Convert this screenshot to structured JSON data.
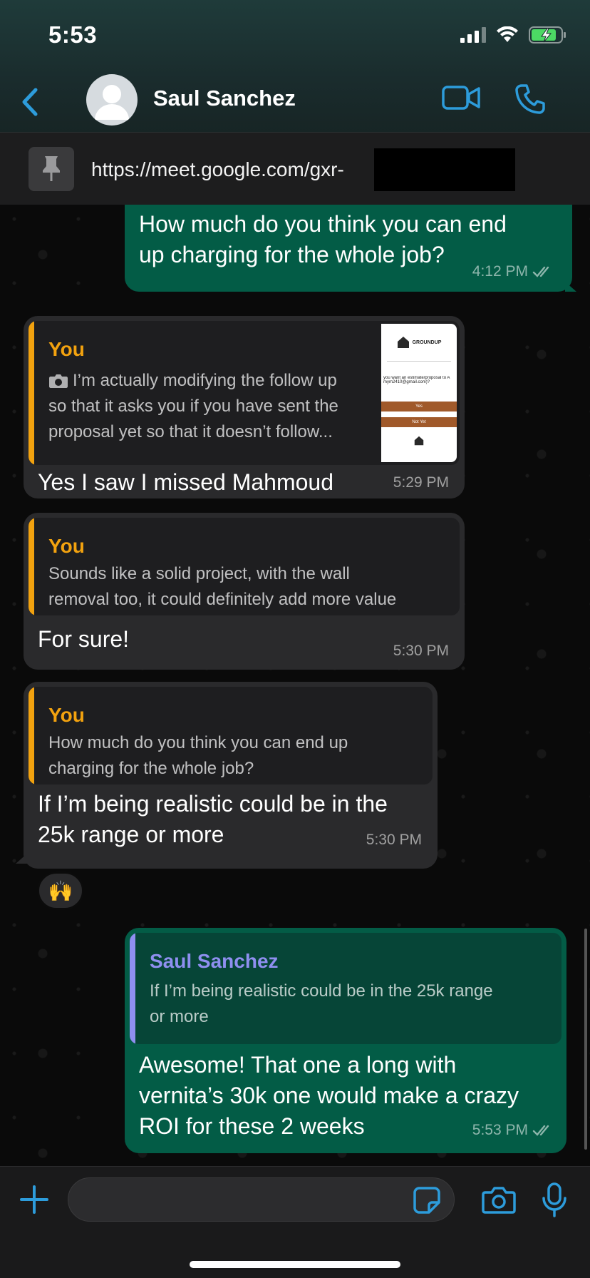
{
  "status": {
    "time": "5:53"
  },
  "header": {
    "contact_name": "Saul Sanchez"
  },
  "pinned": {
    "text": "https://meet.google.com/gxr-"
  },
  "messages": [
    {
      "direction": "outgoing",
      "text_lines": [
        "How much do you think you can end",
        "up charging for the whole job?"
      ],
      "time": "4:12 PM"
    },
    {
      "direction": "incoming",
      "quote_author": "You",
      "quote_lines": [
        "I’m actually modifying the follow up",
        "so that it asks you if you have sent the",
        "proposal yet so that it doesn’t follow..."
      ],
      "quote_has_photo": true,
      "thumb": {
        "brand": "GROUNDUP",
        "line1": "you want an estimate/proposal to A",
        "line2": "mym2410@gmail.com)?",
        "btn1": "Yes",
        "btn2": "Not Yet"
      },
      "text": "Yes I saw I missed Mahmoud",
      "time": "5:29 PM"
    },
    {
      "direction": "incoming",
      "quote_author": "You",
      "quote_lines": [
        "Sounds like a solid project, with the wall",
        "removal too, it could definitely add more value"
      ],
      "text": "For sure!",
      "time": "5:30 PM"
    },
    {
      "direction": "incoming",
      "quote_author": "You",
      "quote_lines": [
        "How much do you think you can end up",
        "charging for the whole job?"
      ],
      "text_lines": [
        "If I’m being realistic could be in the",
        "25k range or more"
      ],
      "time": "5:30 PM",
      "reaction": "🙌"
    },
    {
      "direction": "outgoing",
      "quote_author": "Saul Sanchez",
      "quote_lines": [
        "If I’m being realistic could be in the 25k range",
        "or more"
      ],
      "text_lines": [
        "Awesome! That one a long with",
        "vernita’s 30k one would make a crazy",
        "ROI for these 2 weeks"
      ],
      "time": "5:53 PM"
    }
  ],
  "colors": {
    "accent": "#2d9cdb",
    "outgoing_bubble": "#035c46",
    "incoming_bubble": "#2a2a2c",
    "you_quote": "#f2a20f",
    "contact_quote": "#8f8ff0"
  }
}
